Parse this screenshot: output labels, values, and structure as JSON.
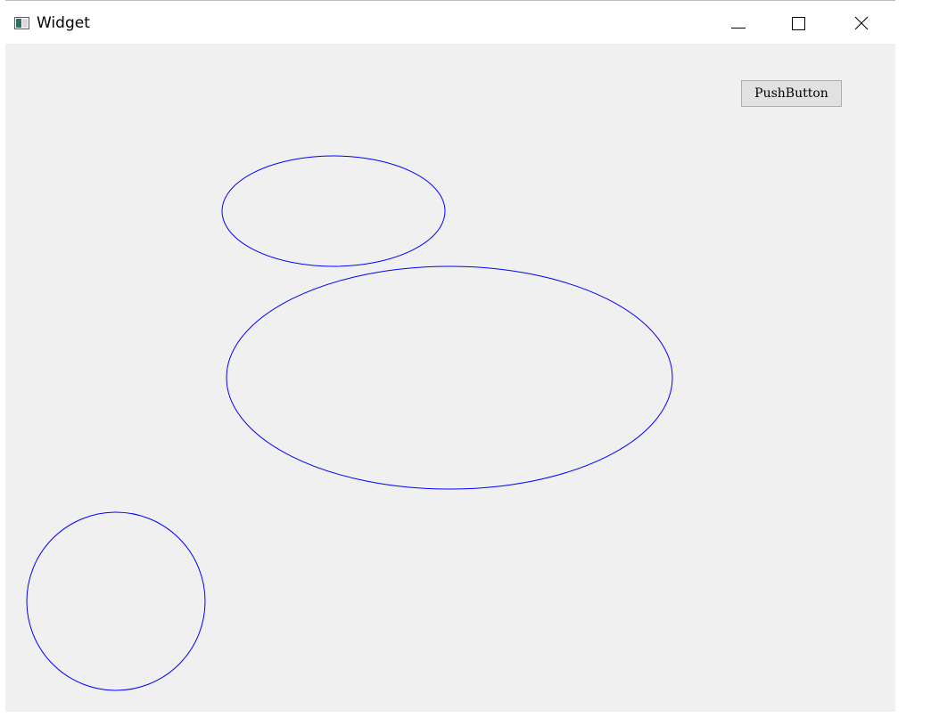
{
  "window": {
    "title": "Widget",
    "icons": {
      "app": "app-window-icon",
      "minimize": "minimize-icon",
      "maximize": "maximize-icon",
      "close": "close-icon"
    }
  },
  "content": {
    "push_button_label": "PushButton"
  },
  "colors": {
    "client_background": "#f0f0f0",
    "shape_stroke": "#0000ff",
    "button_background": "#e1e1e1",
    "button_border": "#adadad"
  }
}
